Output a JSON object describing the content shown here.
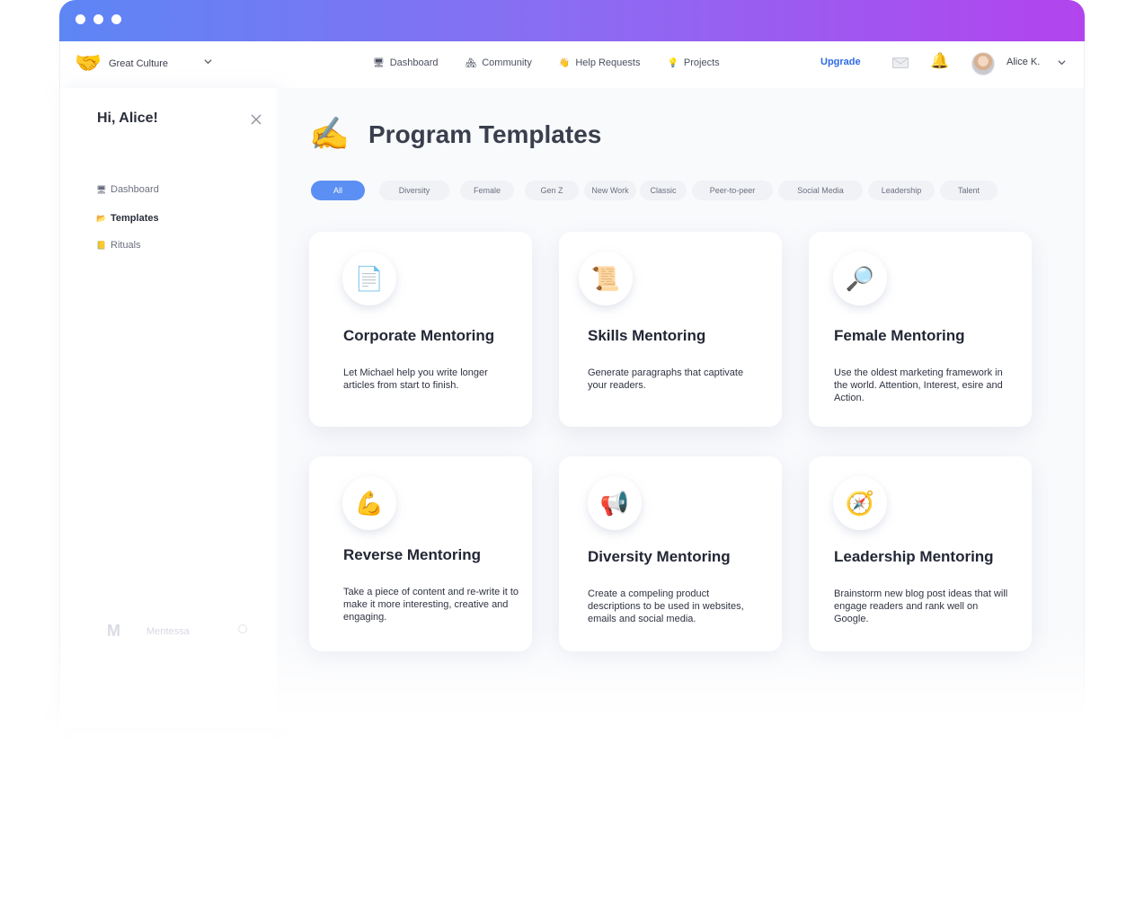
{
  "window": {
    "accent_gradient": [
      "#5d86f5",
      "#8b6cf2",
      "#b244ee"
    ]
  },
  "org": {
    "logo_icon": "handshake-icon",
    "logo_glyph": "🤝",
    "name": "Great Culture"
  },
  "nav": {
    "links": [
      {
        "label": "Dashboard",
        "glyph": "🖥"
      },
      {
        "label": "Community",
        "glyph": "🏘"
      },
      {
        "label": "Help Requests",
        "glyph": "👋"
      },
      {
        "label": "Projects",
        "glyph": "💡"
      }
    ],
    "upgrade_label": "Upgrade",
    "upgrade_color": "#2f6ae6",
    "bell_glyph": "🔔",
    "user_name": "Alice K."
  },
  "sidebar": {
    "greeting": "Hi, Alice!",
    "items": [
      {
        "label": "Dashboard",
        "glyph": "🖥"
      },
      {
        "label": "Templates",
        "glyph": "📂"
      },
      {
        "label": "Rituals",
        "glyph": "📒"
      }
    ],
    "brand_logo": "M",
    "brand_name": "Mentessa"
  },
  "main": {
    "title_glyph": "✍️",
    "title": "Program Templates",
    "filters": [
      "All",
      "Diversity",
      "Female",
      "Gen Z",
      "New Work",
      "Classic",
      "Peer-to-peer",
      "Social Media",
      "Leadership",
      "Talent"
    ],
    "active_filter_color": "#5b8ff3",
    "cards": [
      {
        "icon": "document-icon",
        "glyph": "📄",
        "title": "Corporate Mentoring",
        "desc": "Let Michael help you write longer articles from start to finish."
      },
      {
        "icon": "scroll-icon",
        "glyph": "📜",
        "title": "Skills Mentoring",
        "desc": "Generate paragraphs that captivate your readers."
      },
      {
        "icon": "magnifier-icon",
        "glyph": "🔎",
        "title": "Female Mentoring",
        "desc": "Use the oldest marketing framework in the world. Attention, Interest, esire and Action."
      },
      {
        "icon": "flexed-biceps-icon",
        "glyph": "💪",
        "title": "Reverse Mentoring",
        "desc": "Take a piece of content and re-write it to make it more interesting, creative and engaging."
      },
      {
        "icon": "megaphone-icon",
        "glyph": "📢",
        "title": "Diversity Mentoring",
        "desc": "Create a compeling product descriptions to be used in websites, emails and social media."
      },
      {
        "icon": "compass-icon",
        "glyph": "🧭",
        "title": "Leadership Mentoring",
        "desc": "Brainstorm new blog post ideas that will engage readers and rank well on Google."
      }
    ]
  }
}
